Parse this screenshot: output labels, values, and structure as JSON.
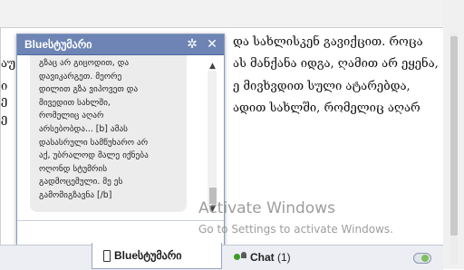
{
  "page": {
    "lines": [
      "და სახლისკენ გავიქცით. როცა",
      "ას მანქანა იდგა, ღამით არ ეყენა,",
      "ე მივხვდით სული ატარებდა,",
      "ადით სახლში, რომელიც აღარ"
    ],
    "left_fragments": [
      "აუ",
      "ი",
      "ე",
      "ე"
    ]
  },
  "chat": {
    "title": "Blueსტუმარი",
    "settings_icon": "✲",
    "close_icon": "✕",
    "message": "გზაც არ გიცოდით, და\nდავიკარგეთ. მეორე\nდილით გზა ვიპოვეთ და\nმივედით სახლში,\nრომელიც აღარ\nარსებობდა... [b] ამას\nდასასრული სამწუხარო არ\nაქ, უბრალოდ მალე იქნება\nოღონდ სტუმრის\nგადმოცემული. მე ეს\nგამომიგზავნა [/b]"
  },
  "watermark": {
    "title": "Activate Windows",
    "subtitle": "Go to Settings to activate Windows."
  },
  "bottom": {
    "tab_label": "Blueსტუმარი",
    "chat_label": "Chat",
    "chat_count": "(1)"
  },
  "colors": {
    "header": "#6d84b4",
    "online": "#3a9d23"
  }
}
